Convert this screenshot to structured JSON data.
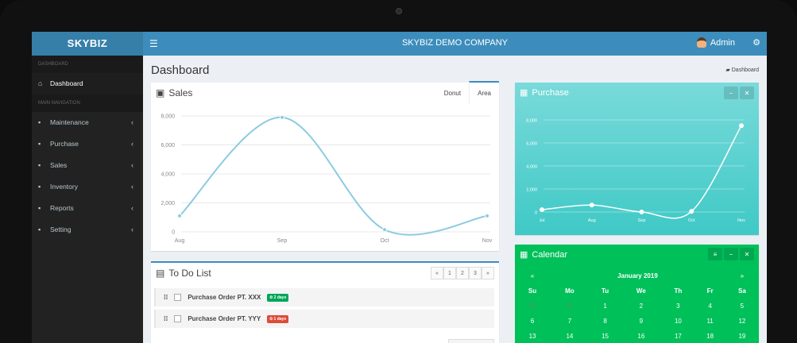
{
  "brand": "SKYBIZ",
  "company": "SKYBIZ DEMO COMPANY",
  "user": "Admin",
  "sidebar": {
    "section1": "DASHBOARD",
    "dashboard": "Dashboard",
    "section2": "MAIN NAVIGATION",
    "items": [
      {
        "label": "Maintenance",
        "icon": "folder-open-icon"
      },
      {
        "label": "Purchase",
        "icon": "book-icon"
      },
      {
        "label": "Sales",
        "icon": "list-icon"
      },
      {
        "label": "Inventory",
        "icon": "briefcase-icon"
      },
      {
        "label": "Reports",
        "icon": "file-icon"
      },
      {
        "label": "Setting",
        "icon": "gears-icon"
      }
    ]
  },
  "page": {
    "title": "Dashboard",
    "breadcrumb": "Dashboard"
  },
  "sales": {
    "title": "Sales",
    "tabs": [
      "Donut",
      "Area"
    ],
    "active_tab": "Area"
  },
  "todo": {
    "title": "To Do List",
    "pages": [
      "«",
      "1",
      "2",
      "3",
      "»"
    ],
    "items": [
      {
        "text": "Purchase Order PT. XXX",
        "badge": "2 days",
        "color": "#00a65a"
      },
      {
        "text": "Purchase Order PT. YYY",
        "badge": "1 days",
        "color": "#dd4b39"
      }
    ]
  },
  "purchase": {
    "title": "Purchase"
  },
  "calendar": {
    "title": "Calendar",
    "month": "January 2019",
    "prev": "«",
    "next": "»",
    "days": [
      "Su",
      "Mo",
      "Tu",
      "We",
      "Th",
      "Fr",
      "Sa"
    ],
    "weeks": [
      [
        "30",
        "31",
        "1",
        "2",
        "3",
        "4",
        "5"
      ],
      [
        "6",
        "7",
        "8",
        "9",
        "10",
        "11",
        "12"
      ],
      [
        "13",
        "14",
        "15",
        "16",
        "17",
        "18",
        "19"
      ]
    ]
  },
  "chart_data": [
    {
      "type": "line",
      "title": "Sales",
      "categories": [
        "Aug",
        "Sep",
        "Oct",
        "Nov"
      ],
      "values": [
        1100,
        7900,
        150,
        1100
      ],
      "yticks": [
        "0",
        "2,000",
        "4,000",
        "6,000",
        "8,000"
      ],
      "ylim": [
        0,
        8000
      ],
      "color": "#8ccbe0"
    },
    {
      "type": "line",
      "title": "Purchase",
      "categories": [
        "Jul",
        "Aug",
        "Sep",
        "Oct",
        "Nov"
      ],
      "values": [
        200,
        600,
        0,
        50,
        7500
      ],
      "yticks": [
        "0",
        "2,000",
        "4,000",
        "6,000",
        "8,000"
      ],
      "ylim": [
        0,
        8000
      ],
      "color": "#ffffff"
    }
  ]
}
